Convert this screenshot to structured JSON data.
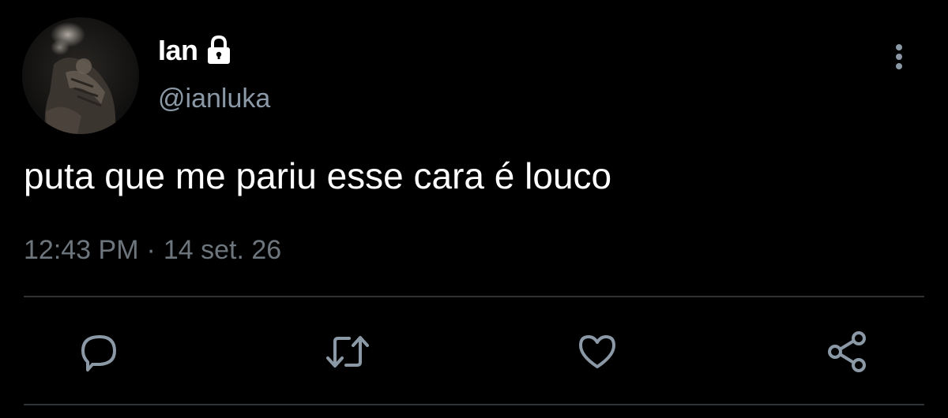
{
  "tweet": {
    "display_name": "Ian",
    "handle": "@ianluka",
    "text": "puta que me pariu esse cara é louco",
    "time": "12:43 PM",
    "separator": "·",
    "date": "14 set. 26"
  },
  "icons": {
    "lock": "lock-icon",
    "more": "more-vertical-icon",
    "reply": "reply-icon",
    "retweet": "retweet-icon",
    "like": "heart-icon",
    "share": "share-icon"
  },
  "colors": {
    "background": "#000000",
    "text": "#ffffff",
    "handle": "#8b98a5",
    "meta": "#6e767d",
    "icon": "#8b98a5",
    "divider": "#2f3336"
  }
}
